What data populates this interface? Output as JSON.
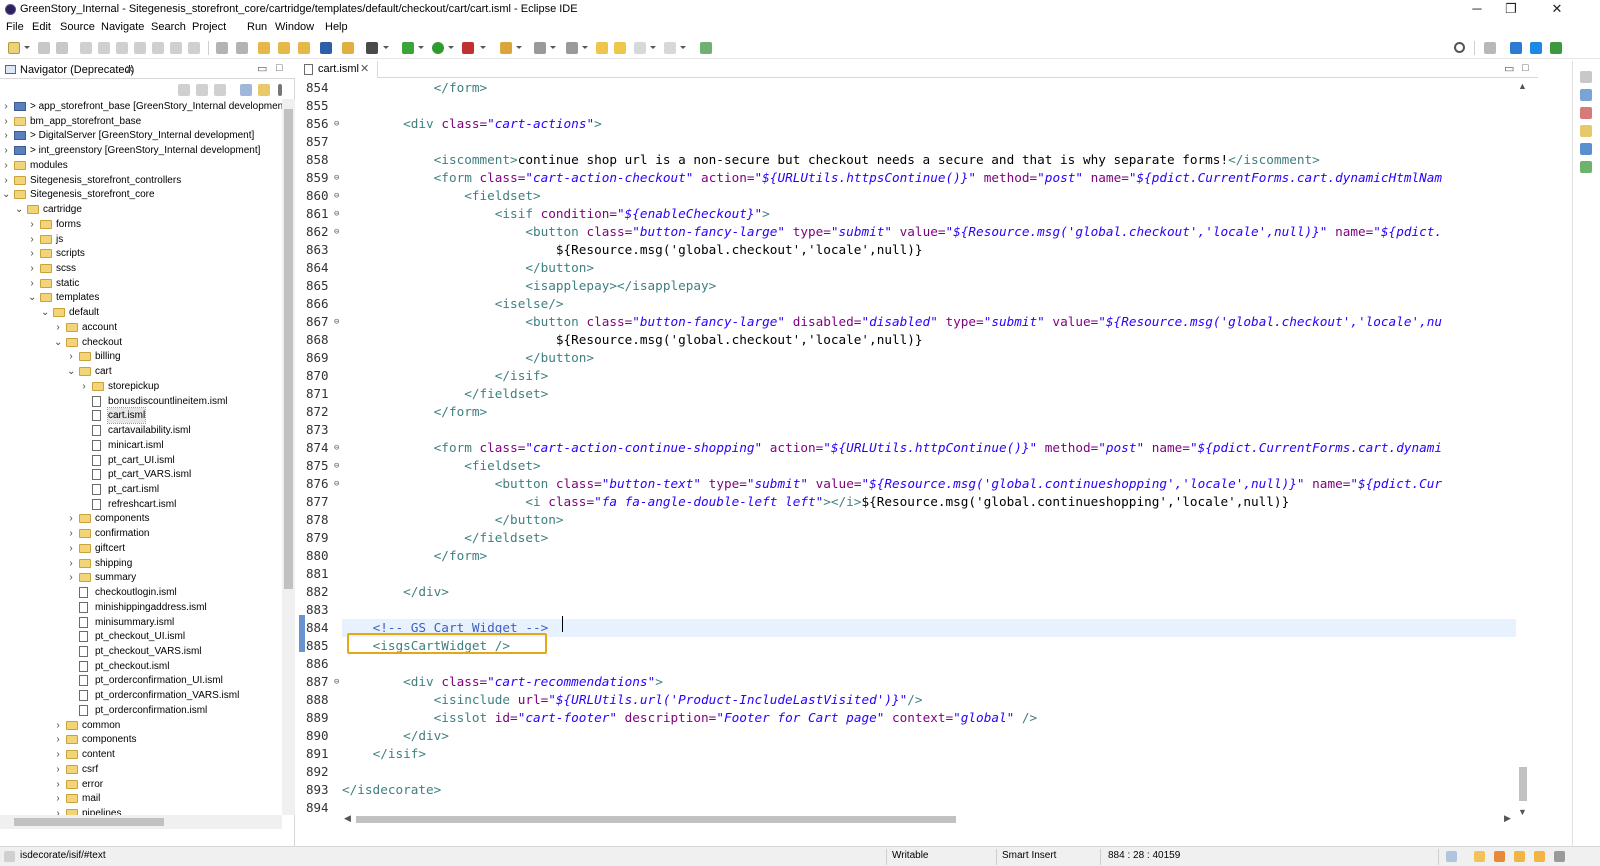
{
  "window": {
    "title": "GreenStory_Internal - Sitegenesis_storefront_core/cartridge/templates/default/checkout/cart/cart.isml - Eclipse IDE",
    "minimize": "─",
    "maximize": "❐",
    "close": "✕"
  },
  "menu": [
    "File",
    "Edit",
    "Source",
    "Navigate",
    "Search",
    "Project",
    "Run",
    "Window",
    "Help"
  ],
  "navigator": {
    "tab_label": "Navigator (Deprecated)",
    "close_glyph": "✕",
    "minimize_glyph": "▭",
    "maximize_glyph": "□",
    "tree": [
      {
        "label": "> app_storefront_base [GreenStory_Internal development",
        "depth": 0,
        "expanded": false,
        "icon": "project"
      },
      {
        "label": "bm_app_storefront_base",
        "depth": 0,
        "expanded": false,
        "icon": "folder"
      },
      {
        "label": "> DigitalServer [GreenStory_Internal development]",
        "depth": 0,
        "expanded": false,
        "icon": "project"
      },
      {
        "label": "> int_greenstory [GreenStory_Internal development]",
        "depth": 0,
        "expanded": false,
        "icon": "project"
      },
      {
        "label": "modules",
        "depth": 0,
        "expanded": false,
        "icon": "folder"
      },
      {
        "label": "Sitegenesis_storefront_controllers",
        "depth": 0,
        "expanded": false,
        "icon": "folder"
      },
      {
        "label": "Sitegenesis_storefront_core",
        "depth": 0,
        "expanded": true,
        "icon": "folder"
      },
      {
        "label": "cartridge",
        "depth": 1,
        "expanded": true,
        "icon": "folder"
      },
      {
        "label": "forms",
        "depth": 2,
        "expanded": false,
        "icon": "folder"
      },
      {
        "label": "js",
        "depth": 2,
        "expanded": false,
        "icon": "folder"
      },
      {
        "label": "scripts",
        "depth": 2,
        "expanded": false,
        "icon": "folder"
      },
      {
        "label": "scss",
        "depth": 2,
        "expanded": false,
        "icon": "folder"
      },
      {
        "label": "static",
        "depth": 2,
        "expanded": false,
        "icon": "folder"
      },
      {
        "label": "templates",
        "depth": 2,
        "expanded": true,
        "icon": "folder"
      },
      {
        "label": "default",
        "depth": 3,
        "expanded": true,
        "icon": "folder"
      },
      {
        "label": "account",
        "depth": 4,
        "expanded": false,
        "icon": "folder"
      },
      {
        "label": "checkout",
        "depth": 4,
        "expanded": true,
        "icon": "folder"
      },
      {
        "label": "billing",
        "depth": 5,
        "expanded": false,
        "icon": "folder"
      },
      {
        "label": "cart",
        "depth": 5,
        "expanded": true,
        "icon": "folder"
      },
      {
        "label": "storepickup",
        "depth": 6,
        "expanded": false,
        "icon": "folder"
      },
      {
        "label": "bonusdiscountlineitem.isml",
        "depth": 6,
        "icon": "file"
      },
      {
        "label": "cart.isml",
        "depth": 6,
        "icon": "file",
        "selected": true
      },
      {
        "label": "cartavailability.isml",
        "depth": 6,
        "icon": "file"
      },
      {
        "label": "minicart.isml",
        "depth": 6,
        "icon": "file"
      },
      {
        "label": "pt_cart_UI.isml",
        "depth": 6,
        "icon": "file"
      },
      {
        "label": "pt_cart_VARS.isml",
        "depth": 6,
        "icon": "file"
      },
      {
        "label": "pt_cart.isml",
        "depth": 6,
        "icon": "file"
      },
      {
        "label": "refreshcart.isml",
        "depth": 6,
        "icon": "file"
      },
      {
        "label": "components",
        "depth": 5,
        "expanded": false,
        "icon": "folder"
      },
      {
        "label": "confirmation",
        "depth": 5,
        "expanded": false,
        "icon": "folder"
      },
      {
        "label": "giftcert",
        "depth": 5,
        "expanded": false,
        "icon": "folder"
      },
      {
        "label": "shipping",
        "depth": 5,
        "expanded": false,
        "icon": "folder"
      },
      {
        "label": "summary",
        "depth": 5,
        "expanded": false,
        "icon": "folder"
      },
      {
        "label": "checkoutlogin.isml",
        "depth": 5,
        "icon": "file"
      },
      {
        "label": "minishippingaddress.isml",
        "depth": 5,
        "icon": "file"
      },
      {
        "label": "minisummary.isml",
        "depth": 5,
        "icon": "file"
      },
      {
        "label": "pt_checkout_UI.isml",
        "depth": 5,
        "icon": "file"
      },
      {
        "label": "pt_checkout_VARS.isml",
        "depth": 5,
        "icon": "file"
      },
      {
        "label": "pt_checkout.isml",
        "depth": 5,
        "icon": "file"
      },
      {
        "label": "pt_orderconfirmation_UI.isml",
        "depth": 5,
        "icon": "file"
      },
      {
        "label": "pt_orderconfirmation_VARS.isml",
        "depth": 5,
        "icon": "file"
      },
      {
        "label": "pt_orderconfirmation.isml",
        "depth": 5,
        "icon": "file"
      },
      {
        "label": "common",
        "depth": 4,
        "expanded": false,
        "icon": "folder"
      },
      {
        "label": "components",
        "depth": 4,
        "expanded": false,
        "icon": "folder"
      },
      {
        "label": "content",
        "depth": 4,
        "expanded": false,
        "icon": "folder"
      },
      {
        "label": "csrf",
        "depth": 4,
        "expanded": false,
        "icon": "folder"
      },
      {
        "label": "error",
        "depth": 4,
        "expanded": false,
        "icon": "folder"
      },
      {
        "label": "mail",
        "depth": 4,
        "expanded": false,
        "icon": "folder"
      },
      {
        "label": "pipelines",
        "depth": 4,
        "expanded": false,
        "icon": "folder"
      }
    ]
  },
  "editor": {
    "tab_label": "cart.isml",
    "close_glyph": "✕",
    "minimize_glyph": "▭",
    "maximize_glyph": "□",
    "current_line": 884,
    "highlighted_line": 885,
    "lines": [
      {
        "n": 854,
        "fold": false,
        "tokens": [
          [
            "            ",
            "text"
          ],
          [
            "</form>",
            "tag"
          ]
        ]
      },
      {
        "n": 855,
        "fold": false,
        "tokens": []
      },
      {
        "n": 856,
        "fold": true,
        "tokens": [
          [
            "        ",
            "text"
          ],
          [
            "<div ",
            "tag"
          ],
          [
            "class=",
            "attr"
          ],
          [
            "\"cart-actions\"",
            "val"
          ],
          [
            ">",
            "tag"
          ]
        ]
      },
      {
        "n": 857,
        "fold": false,
        "tokens": []
      },
      {
        "n": 858,
        "fold": false,
        "tokens": [
          [
            "            ",
            "text"
          ],
          [
            "<iscomment>",
            "tag"
          ],
          [
            "continue shop url is a non-secure but checkout needs a secure and that is why separate forms!",
            "text"
          ],
          [
            "</iscomment>",
            "tag"
          ]
        ]
      },
      {
        "n": 859,
        "fold": true,
        "tokens": [
          [
            "            ",
            "text"
          ],
          [
            "<form ",
            "tag"
          ],
          [
            "class=",
            "attr"
          ],
          [
            "\"cart-action-checkout\"",
            "val"
          ],
          [
            " action=",
            "attr"
          ],
          [
            "\"${URLUtils.httpsContinue()}\"",
            "val"
          ],
          [
            " method=",
            "attr"
          ],
          [
            "\"post\"",
            "val"
          ],
          [
            " name=",
            "attr"
          ],
          [
            "\"${pdict.CurrentForms.cart.dynamicHtmlNam",
            "val"
          ]
        ]
      },
      {
        "n": 860,
        "fold": true,
        "tokens": [
          [
            "                ",
            "text"
          ],
          [
            "<fieldset>",
            "tag"
          ]
        ]
      },
      {
        "n": 861,
        "fold": true,
        "tokens": [
          [
            "                    ",
            "text"
          ],
          [
            "<isif ",
            "tag"
          ],
          [
            "condition=",
            "attr"
          ],
          [
            "\"${enableCheckout}\"",
            "val"
          ],
          [
            ">",
            "tag"
          ]
        ]
      },
      {
        "n": 862,
        "fold": true,
        "tokens": [
          [
            "                        ",
            "text"
          ],
          [
            "<button ",
            "tag"
          ],
          [
            "class=",
            "attr"
          ],
          [
            "\"button-fancy-large\"",
            "val"
          ],
          [
            " type=",
            "attr"
          ],
          [
            "\"submit\"",
            "val"
          ],
          [
            " value=",
            "attr"
          ],
          [
            "\"${Resource.msg('global.checkout','locale',null)}\"",
            "val"
          ],
          [
            " name=",
            "attr"
          ],
          [
            "\"${pdict.",
            "val"
          ]
        ]
      },
      {
        "n": 863,
        "fold": false,
        "tokens": [
          [
            "                            ${Resource.msg('global.checkout','locale',null)}",
            "text"
          ]
        ]
      },
      {
        "n": 864,
        "fold": false,
        "tokens": [
          [
            "                        ",
            "text"
          ],
          [
            "</button>",
            "tag"
          ]
        ]
      },
      {
        "n": 865,
        "fold": false,
        "tokens": [
          [
            "                        ",
            "text"
          ],
          [
            "<isapplepay></isapplepay>",
            "tag"
          ]
        ]
      },
      {
        "n": 866,
        "fold": false,
        "tokens": [
          [
            "                    ",
            "text"
          ],
          [
            "<iselse/>",
            "tag"
          ]
        ]
      },
      {
        "n": 867,
        "fold": true,
        "tokens": [
          [
            "                        ",
            "text"
          ],
          [
            "<button ",
            "tag"
          ],
          [
            "class=",
            "attr"
          ],
          [
            "\"button-fancy-large\"",
            "val"
          ],
          [
            " disabled=",
            "attr"
          ],
          [
            "\"disabled\"",
            "val"
          ],
          [
            " type=",
            "attr"
          ],
          [
            "\"submit\"",
            "val"
          ],
          [
            " value=",
            "attr"
          ],
          [
            "\"${Resource.msg('global.checkout','locale',nu",
            "val"
          ]
        ]
      },
      {
        "n": 868,
        "fold": false,
        "tokens": [
          [
            "                            ${Resource.msg('global.checkout','locale',null)}",
            "text"
          ]
        ]
      },
      {
        "n": 869,
        "fold": false,
        "tokens": [
          [
            "                        ",
            "text"
          ],
          [
            "</button>",
            "tag"
          ]
        ]
      },
      {
        "n": 870,
        "fold": false,
        "tokens": [
          [
            "                    ",
            "text"
          ],
          [
            "</isif>",
            "tag"
          ]
        ]
      },
      {
        "n": 871,
        "fold": false,
        "tokens": [
          [
            "                ",
            "text"
          ],
          [
            "</fieldset>",
            "tag"
          ]
        ]
      },
      {
        "n": 872,
        "fold": false,
        "tokens": [
          [
            "            ",
            "text"
          ],
          [
            "</form>",
            "tag"
          ]
        ]
      },
      {
        "n": 873,
        "fold": false,
        "tokens": []
      },
      {
        "n": 874,
        "fold": true,
        "tokens": [
          [
            "            ",
            "text"
          ],
          [
            "<form ",
            "tag"
          ],
          [
            "class=",
            "attr"
          ],
          [
            "\"cart-action-continue-shopping\"",
            "val"
          ],
          [
            " action=",
            "attr"
          ],
          [
            "\"${URLUtils.httpContinue()}\"",
            "val"
          ],
          [
            " method=",
            "attr"
          ],
          [
            "\"post\"",
            "val"
          ],
          [
            " name=",
            "attr"
          ],
          [
            "\"${pdict.CurrentForms.cart.dynami",
            "val"
          ]
        ]
      },
      {
        "n": 875,
        "fold": true,
        "tokens": [
          [
            "                ",
            "text"
          ],
          [
            "<fieldset>",
            "tag"
          ]
        ]
      },
      {
        "n": 876,
        "fold": true,
        "tokens": [
          [
            "                    ",
            "text"
          ],
          [
            "<button ",
            "tag"
          ],
          [
            "class=",
            "attr"
          ],
          [
            "\"button-text\"",
            "val"
          ],
          [
            " type=",
            "attr"
          ],
          [
            "\"submit\"",
            "val"
          ],
          [
            " value=",
            "attr"
          ],
          [
            "\"${Resource.msg('global.continueshopping','locale',null)}\"",
            "val"
          ],
          [
            " name=",
            "attr"
          ],
          [
            "\"${pdict.Cur",
            "val"
          ]
        ]
      },
      {
        "n": 877,
        "fold": false,
        "tokens": [
          [
            "                        ",
            "text"
          ],
          [
            "<i ",
            "tag"
          ],
          [
            "class=",
            "attr"
          ],
          [
            "\"fa fa-angle-double-left left\"",
            "val"
          ],
          [
            "></i>",
            "tag"
          ],
          [
            "${Resource.msg('global.continueshopping','locale',null)}",
            "text"
          ]
        ]
      },
      {
        "n": 878,
        "fold": false,
        "tokens": [
          [
            "                    ",
            "text"
          ],
          [
            "</button>",
            "tag"
          ]
        ]
      },
      {
        "n": 879,
        "fold": false,
        "tokens": [
          [
            "                ",
            "text"
          ],
          [
            "</fieldset>",
            "tag"
          ]
        ]
      },
      {
        "n": 880,
        "fold": false,
        "tokens": [
          [
            "            ",
            "text"
          ],
          [
            "</form>",
            "tag"
          ]
        ]
      },
      {
        "n": 881,
        "fold": false,
        "tokens": []
      },
      {
        "n": 882,
        "fold": false,
        "tokens": [
          [
            "        ",
            "text"
          ],
          [
            "</div>",
            "tag"
          ]
        ]
      },
      {
        "n": 883,
        "fold": false,
        "tokens": []
      },
      {
        "n": 884,
        "fold": false,
        "tokens": [
          [
            "    ",
            "text"
          ],
          [
            "<!-- GS Cart Widget -->",
            "comment"
          ]
        ]
      },
      {
        "n": 885,
        "fold": false,
        "tokens": [
          [
            "    ",
            "text"
          ],
          [
            "<isgsCartWidget />",
            "tag"
          ]
        ]
      },
      {
        "n": 886,
        "fold": false,
        "tokens": []
      },
      {
        "n": 887,
        "fold": true,
        "tokens": [
          [
            "        ",
            "text"
          ],
          [
            "<div ",
            "tag"
          ],
          [
            "class=",
            "attr"
          ],
          [
            "\"cart-recommendations\"",
            "val"
          ],
          [
            ">",
            "tag"
          ]
        ]
      },
      {
        "n": 888,
        "fold": false,
        "tokens": [
          [
            "            ",
            "text"
          ],
          [
            "<isinclude ",
            "tag"
          ],
          [
            "url=",
            "attr"
          ],
          [
            "\"${URLUtils.url('Product-IncludeLastVisited')}\"",
            "val"
          ],
          [
            "/>",
            "tag"
          ]
        ]
      },
      {
        "n": 889,
        "fold": false,
        "tokens": [
          [
            "            ",
            "text"
          ],
          [
            "<isslot ",
            "tag"
          ],
          [
            "id=",
            "attr"
          ],
          [
            "\"cart-footer\"",
            "val"
          ],
          [
            " description=",
            "attr"
          ],
          [
            "\"Footer for Cart page\"",
            "val"
          ],
          [
            " context=",
            "attr"
          ],
          [
            "\"global\"",
            "val"
          ],
          [
            " />",
            "tag"
          ]
        ]
      },
      {
        "n": 890,
        "fold": false,
        "tokens": [
          [
            "        ",
            "text"
          ],
          [
            "</div>",
            "tag"
          ]
        ]
      },
      {
        "n": 891,
        "fold": false,
        "tokens": [
          [
            "    ",
            "text"
          ],
          [
            "</isif>",
            "tag"
          ]
        ]
      },
      {
        "n": 892,
        "fold": false,
        "tokens": []
      },
      {
        "n": 893,
        "fold": false,
        "tokens": [
          [
            "</isdecorate>",
            "tag"
          ]
        ]
      },
      {
        "n": 894,
        "fold": false,
        "tokens": []
      }
    ]
  },
  "status": {
    "path": "isdecorate/isif/#text",
    "mode": "Writable",
    "insert": "Smart Insert",
    "position": "884 : 28 : 40159"
  },
  "colors": {
    "tag": "#3f7f7f",
    "attr": "#7f007f",
    "value": "#2a00ff",
    "comment": "#3f5fbf",
    "highlight_box": "#e4a716",
    "current_line": "#e8f2fe"
  }
}
